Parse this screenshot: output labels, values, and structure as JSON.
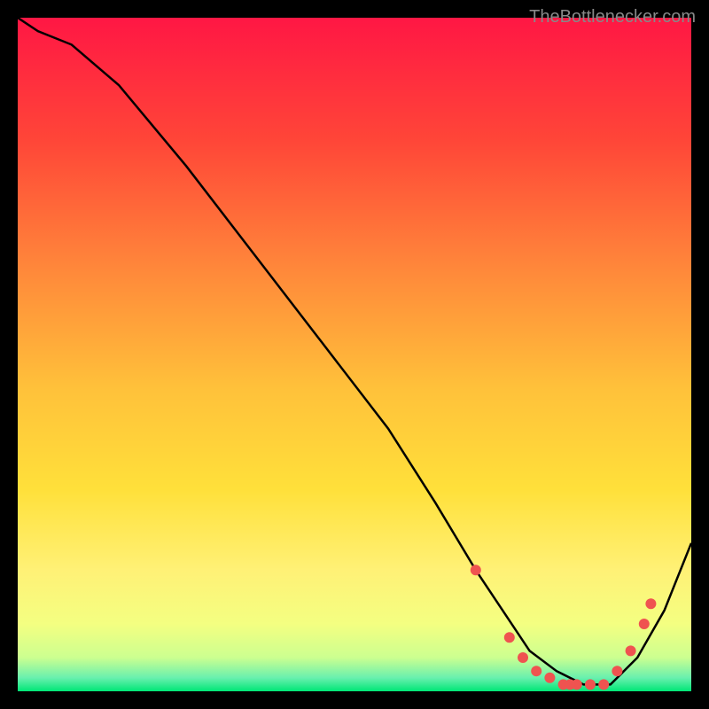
{
  "watermark": "TheBottlenecker.com",
  "chart_data": {
    "type": "line",
    "title": "",
    "xlabel": "",
    "ylabel": "",
    "xlim": [
      0,
      100
    ],
    "ylim": [
      0,
      100
    ],
    "gradient_colors": {
      "top": "#ff1744",
      "upper_mid": "#ff6d3a",
      "mid": "#ffd740",
      "lower_mid": "#ffeb3b",
      "low": "#f4ff81",
      "bottom": "#00e676"
    },
    "series": [
      {
        "name": "curve",
        "type": "line",
        "color": "#000000",
        "x": [
          0,
          3,
          8,
          15,
          25,
          35,
          45,
          55,
          62,
          68,
          72,
          76,
          80,
          84,
          88,
          92,
          96,
          100
        ],
        "y": [
          100,
          98,
          96,
          90,
          78,
          65,
          52,
          39,
          28,
          18,
          12,
          6,
          3,
          1,
          1,
          5,
          12,
          22
        ]
      },
      {
        "name": "dots",
        "type": "scatter",
        "color": "#ef5350",
        "x": [
          68,
          73,
          75,
          77,
          79,
          81,
          82,
          83,
          85,
          87,
          89,
          91,
          93,
          94
        ],
        "y": [
          18,
          8,
          5,
          3,
          2,
          1,
          1,
          1,
          1,
          1,
          3,
          6,
          10,
          13
        ]
      }
    ]
  }
}
